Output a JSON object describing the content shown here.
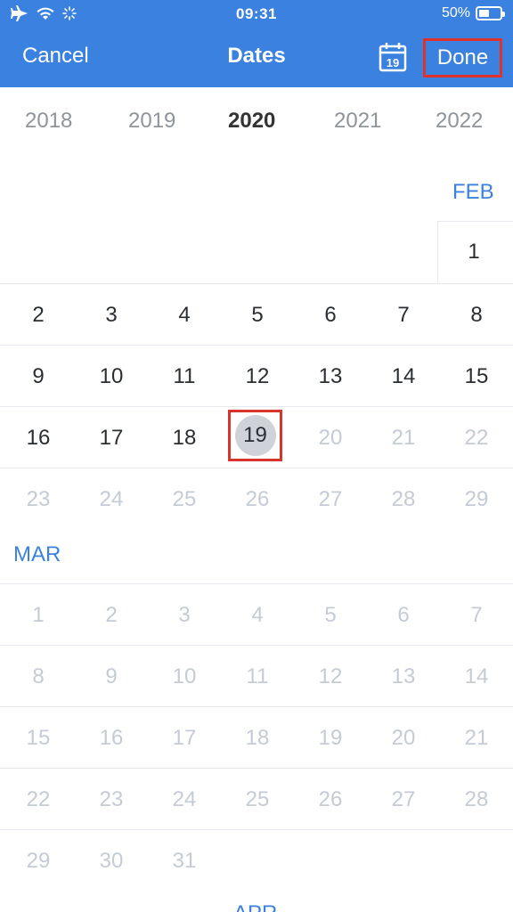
{
  "status": {
    "time": "09:31",
    "battery": "50%"
  },
  "nav": {
    "cancel": "Cancel",
    "title": "Dates",
    "calendar_icon_day": "19",
    "done": "Done"
  },
  "years": [
    "2018",
    "2019",
    "2020",
    "2021",
    "2022"
  ],
  "selected_year": "2020",
  "feb": {
    "label": "FEB",
    "first_row": [
      "1"
    ],
    "rows": [
      [
        "2",
        "3",
        "4",
        "5",
        "6",
        "7",
        "8"
      ],
      [
        "9",
        "10",
        "11",
        "12",
        "13",
        "14",
        "15"
      ],
      [
        "16",
        "17",
        "18",
        "19",
        "20",
        "21",
        "22"
      ],
      [
        "23",
        "24",
        "25",
        "26",
        "27",
        "28",
        "29"
      ]
    ],
    "selected_day": "19"
  },
  "mar": {
    "label": "MAR",
    "rows": [
      [
        "1",
        "2",
        "3",
        "4",
        "5",
        "6",
        "7"
      ],
      [
        "8",
        "9",
        "10",
        "11",
        "12",
        "13",
        "14"
      ],
      [
        "15",
        "16",
        "17",
        "18",
        "19",
        "20",
        "21"
      ],
      [
        "22",
        "23",
        "24",
        "25",
        "26",
        "27",
        "28"
      ],
      [
        "29",
        "30",
        "31"
      ]
    ]
  },
  "apr": {
    "label": "APR"
  },
  "colors": {
    "accent": "#3b82e0",
    "highlight_box": "#e0322c",
    "dim_text": "#c5cbd6"
  }
}
